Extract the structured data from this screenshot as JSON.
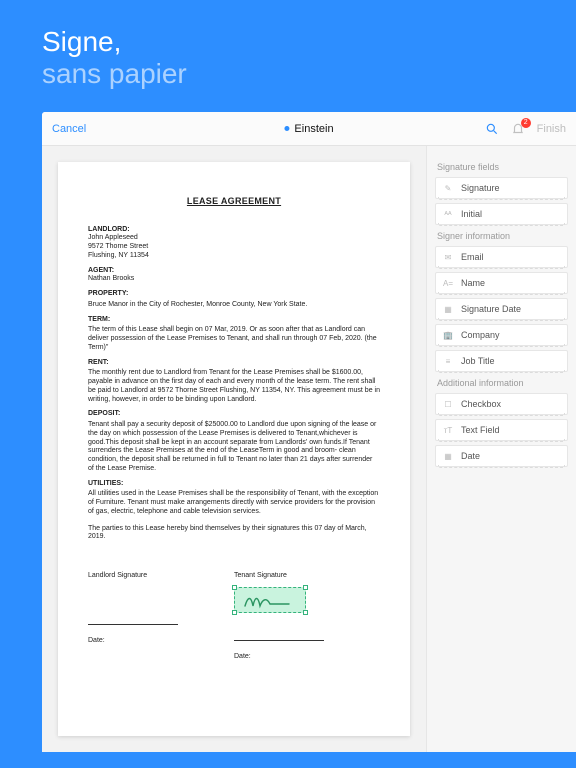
{
  "hero": {
    "line1": "Signe,",
    "line2": "sans papier"
  },
  "toolbar": {
    "cancel": "Cancel",
    "title": "Einstein",
    "finish": "Finish",
    "badge": "2"
  },
  "doc": {
    "title": "LEASE AGREEMENT",
    "landlord_lbl": "LANDLORD:",
    "landlord_name": "John Appleseed",
    "landlord_addr1": "9572 Thorne Street",
    "landlord_addr2": "Flushing, NY 11354",
    "agent_lbl": "AGENT:",
    "agent_name": "Nathan Brooks",
    "property_lbl": "PROPERTY:",
    "property": "Bruce Manor in the City of Rochester, Monroe County, New York State.",
    "term_lbl": "TERM:",
    "term": "The term of this Lease shall begin on 07 Mar, 2019. Or as soon after that as Landlord can deliver possession of the Lease Premises to Tenant, and shall run through 07 Feb, 2020. (the Term)\"",
    "rent_lbl": "RENT:",
    "rent": "The monthly rent due to Landlord from Tenant for the Lease Premises shall be $1600.00, payable in advance on the first day of each and every month of the lease term. The rent shall be paid to Landlord at 9572 Thorne Street Flushing, NY 11354, NY. This agreement must be in writing, however, in order to be binding upon Landlord.",
    "deposit_lbl": "DEPOSIT:",
    "deposit": "Tenant shall pay a security deposit of $25000.00 to Landlord due upon signing of the lease or the day on which possession of the Lease Premises is delivered to Tenant,whichever is good.This deposit shall be kept in an account separate from Landlords' own funds.If Tenant surrenders the Lease Premises at the end of the LeaseTerm in good and broom- clean condition, the deposit shall be returned in full to Tenant no later than 21 days after surrender of the Lease Premise.",
    "util_lbl": "UTILITIES:",
    "util": "All utilities used in the Lease Premises shall be the responsibility of Tenant, with the exception of Furniture. Tenant must make arrangements directly with service providers for the provision of gas, electric, telephone and cable television services.",
    "closing": "The parties to this Lease hereby bind themselves by their signatures this 07 day of March, 2019.",
    "ls": "Landlord Signature",
    "ts": "Tenant Signature",
    "date": "Date:"
  },
  "sections": {
    "sigfields": "Signature fields",
    "signer": "Signer information",
    "addl": "Additional information"
  },
  "fields": {
    "signature": "Signature",
    "initial": "Initial",
    "email": "Email",
    "name": "Name",
    "sigdate": "Signature Date",
    "company": "Company",
    "jobtitle": "Job Title",
    "checkbox": "Checkbox",
    "textfield": "Text Field",
    "date": "Date"
  }
}
